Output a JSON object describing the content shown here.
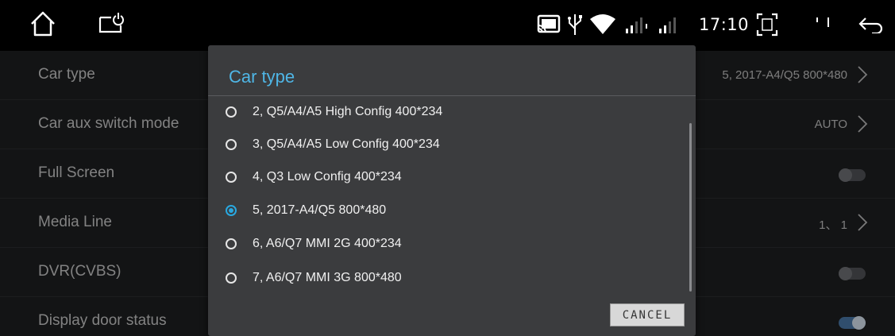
{
  "status_bar": {
    "time": "17:10",
    "icons": [
      "home-icon",
      "power-recent-icon",
      "cast-icon",
      "usb-icon",
      "wifi-icon",
      "signal-icon",
      "signal-icon",
      "screenshot-icon",
      "back-icon"
    ]
  },
  "settings": {
    "rows": [
      {
        "label": "Car type",
        "value": "5, 2017-A4/Q5 800*480"
      },
      {
        "label": "Car aux switch mode",
        "value": "AUTO"
      },
      {
        "label": "Full Screen"
      },
      {
        "label": "Media Line",
        "value": "1、 1"
      },
      {
        "label": "DVR(CVBS)"
      },
      {
        "label": "Display door status"
      }
    ],
    "toggles": {
      "full_screen": false,
      "dvr": false,
      "display_door_status": true
    }
  },
  "dialog": {
    "title": "Car type",
    "options": [
      {
        "label": "2, Q5/A4/A5 High Config 400*234",
        "selected": false
      },
      {
        "label": "3, Q5/A4/A5 Low Config 400*234",
        "selected": false
      },
      {
        "label": "4, Q3 Low Config 400*234",
        "selected": false
      },
      {
        "label": "5, 2017-A4/Q5 800*480",
        "selected": true
      },
      {
        "label": "6, A6/Q7 MMI 2G 400*234",
        "selected": false
      },
      {
        "label": "7, A6/Q7 MMI 3G 800*480",
        "selected": false
      }
    ],
    "cancel_label": "CANCEL"
  },
  "colors": {
    "accent": "#29a8e0",
    "title": "#4fb6e6",
    "toggle_on": "#4a79a8"
  }
}
